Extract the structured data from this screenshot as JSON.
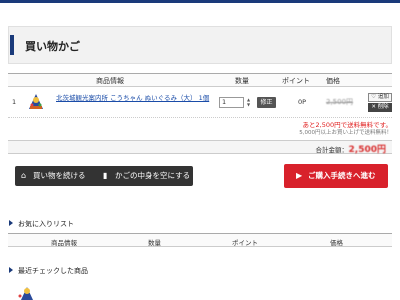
{
  "page": {
    "title": "買い物かご"
  },
  "cart": {
    "headers": {
      "product": "商品情報",
      "quantity": "数量",
      "point": "ポイント",
      "price": "価格"
    },
    "items": [
      {
        "num": "1",
        "name": "北茨城観光案内所 こうちゃん ぬいぐるみ（大） 1個",
        "quantity": "1",
        "fix_label": "修正",
        "point": "0P",
        "price": "2,500円",
        "fav_label": "♡ 追加",
        "delete_label": "✕ 削除"
      }
    ],
    "shipping_note": "あと2,500円で送料無料です。",
    "shipping_sub": "5,000円以上お買い上げで送料無料！",
    "total_label": "合計金額：",
    "total_value": "2,500円"
  },
  "actions": {
    "continue_label": "買い物を続ける",
    "empty_label": "かごの中身を空にする",
    "checkout_label": "ご購入手続きへ進む"
  },
  "favorites": {
    "title": "お気に入りリスト",
    "headers": {
      "product": "商品情報",
      "quantity": "数量",
      "point": "ポイント",
      "price": "価格"
    }
  },
  "recent": {
    "title": "最近チェックした商品"
  },
  "icons": {
    "home": "home-icon",
    "trash": "trash-icon",
    "cart": "cart-icon",
    "heart": "heart-icon",
    "close": "close-icon"
  },
  "colors": {
    "accent": "#1a3a7a",
    "checkout": "#d8212b",
    "link": "#1a4ca8",
    "warning": "#e02020"
  }
}
